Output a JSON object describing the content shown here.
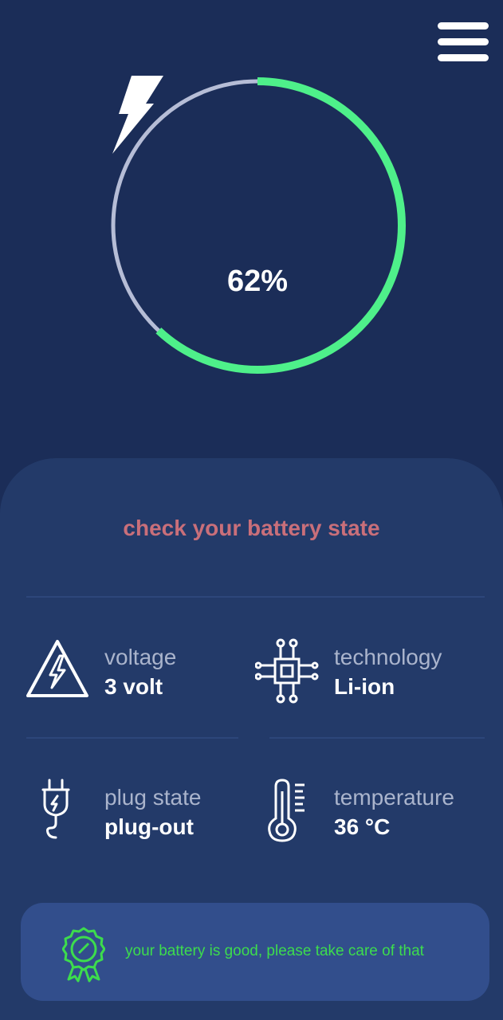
{
  "header": {
    "menu_icon": "hamburger-menu-icon"
  },
  "gauge": {
    "level_percent": 62,
    "percent_label": "62%",
    "icon": "lightning-bolt-icon",
    "colors": {
      "fill": "#4ef08a",
      "track": "#b6bdd6",
      "text": "#ffffff"
    }
  },
  "panel": {
    "title": "check your battery state",
    "stats": [
      {
        "label": "voltage",
        "value": "3 volt",
        "icon": "high-voltage-warning-icon"
      },
      {
        "label": "technology",
        "value": "Li-ion",
        "icon": "circuit-chip-icon"
      },
      {
        "label": "plug state",
        "value": "plug-out",
        "icon": "electric-plug-icon"
      },
      {
        "label": "temperature",
        "value": "36 °C",
        "icon": "thermometer-icon"
      }
    ]
  },
  "status": {
    "message": "your battery is good, please take care of that",
    "icon": "award-badge-icon",
    "color": "#3ddc4d"
  },
  "colors": {
    "background": "#1b2d58",
    "panel": "#233a69",
    "card": "#324e8c",
    "title": "#c96f7a"
  }
}
